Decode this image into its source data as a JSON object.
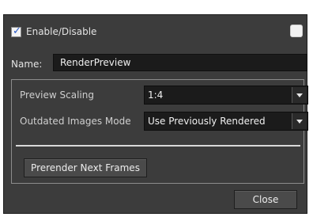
{
  "enable": {
    "label": "Enable/Disable",
    "checked": true
  },
  "name_field": {
    "label": "Name:",
    "value": "RenderPreview"
  },
  "preview_scaling": {
    "label": "Preview Scaling",
    "value": "1:4"
  },
  "outdated_images_mode": {
    "label": "Outdated Images Mode",
    "value": "Use Previously Rendered"
  },
  "buttons": {
    "prerender": "Prerender Next Frames",
    "close": "Close"
  },
  "colors": {
    "panel_bg": "#3c3c3c",
    "field_bg": "#1b1b1b",
    "checkbox_tick": "#2a5ac8",
    "swatch": "#f2f2f2"
  }
}
